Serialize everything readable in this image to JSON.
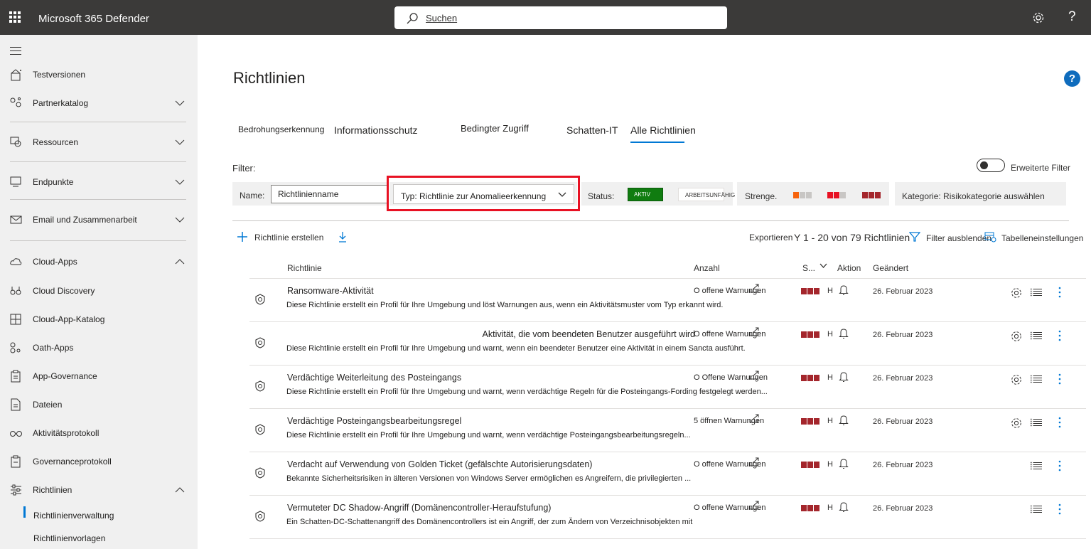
{
  "app": {
    "title": "Microsoft 365 Defender",
    "search_placeholder": "Suchen",
    "help": "?"
  },
  "sidebar": {
    "items": [
      {
        "label": "Testversionen",
        "icon": "trial-icon"
      },
      {
        "label": "Partnerkatalog",
        "icon": "partner-icon"
      },
      {
        "label": "Ressourcen",
        "icon": "resources-icon"
      },
      {
        "label": "Endpunkte",
        "icon": "endpoints-icon"
      },
      {
        "label": "Email und Zusammenarbeit",
        "icon": "email-icon"
      },
      {
        "label": "Cloud-Apps",
        "icon": "cloud-icon"
      },
      {
        "label": "Cloud Discovery",
        "icon": "binoculars-icon"
      },
      {
        "label": "Cloud-App-Katalog",
        "icon": "catalog-icon"
      },
      {
        "label": "Oath-Apps",
        "icon": "oauth-icon"
      },
      {
        "label": "App-Governance",
        "icon": "governance-icon"
      },
      {
        "label": "Dateien",
        "icon": "files-icon"
      },
      {
        "label": "Aktivitätsprotokoll",
        "icon": "glasses-icon"
      },
      {
        "label": "Governanceprotokoll",
        "icon": "log-icon"
      },
      {
        "label": "Richtlinien",
        "icon": "policies-icon"
      }
    ],
    "sub_items": [
      {
        "label": "Richtlinienverwaltung",
        "active": true
      },
      {
        "label": "Richtlinienvorlagen",
        "active": false
      }
    ]
  },
  "page": {
    "title": "Richtlinien",
    "help_label": "?"
  },
  "tabs": [
    {
      "label": "Bedrohungserkennung"
    },
    {
      "label": "Informationsschutz"
    },
    {
      "label": "Bedingter Zugriff"
    },
    {
      "label": "Schatten-IT"
    },
    {
      "label": "Alle Richtlinien",
      "active": true
    }
  ],
  "filters": {
    "label": "Filter:",
    "advanced_label": "Erweiterte Filter",
    "name_label": "Name:",
    "name_value": "Richtlinienname",
    "type_value": "Typ: Richtlinie zur Anomalieerkennung",
    "status_label": "Status:",
    "status_active": "AKTIV",
    "status_broken": "ARBEITSUNFÄHIG",
    "severity_label": "Strenge.",
    "category_value": "Kategorie: Risikokategorie auswählen"
  },
  "toolbar": {
    "create_label": "Richtlinie erstellen",
    "export_label": "Exportieren",
    "range_label": "Y 1 - 20 von 79 Richtlinien",
    "hide_filter_label": "Filter ausblenden",
    "table_settings_label": "Tabelleneinstellungen"
  },
  "table": {
    "headers": {
      "policy": "Richtlinie",
      "count": "Anzahl",
      "severity": "S...",
      "action": "Aktion",
      "modified": "Geändert"
    },
    "rows": [
      {
        "title": "Ransomware-Aktivität",
        "desc": "Diese Richtlinie erstellt ein Profil für Ihre Umgebung und löst Warnungen aus, wenn ein Aktivitätsmuster vom Typ erkannt wird.",
        "count": "O offene Warnungen",
        "h": "H",
        "date": "26. Februar 2023",
        "gear": true
      },
      {
        "title": "Aktivität, die vom beendeten Benutzer ausgeführt wird",
        "desc": "Diese Richtlinie erstellt ein Profil für Ihre Umgebung und warnt, wenn ein beendeter Benutzer eine Aktivität in einem Sancta ausführt.",
        "count": "O offene Warnungen",
        "h": "H",
        "date": "26. Februar 2023",
        "gear": true
      },
      {
        "title": "Verdächtige Weiterleitung des Posteingangs",
        "desc": "Diese Richtlinie erstellt ein Profil für Ihre Umgebung und warnt, wenn verdächtige Regeln für die Posteingangs-Fording festgelegt werden...",
        "count": "O Offene Warnungen",
        "h": "H",
        "date": "26. Februar 2023",
        "gear": true
      },
      {
        "title": "Verdächtige Posteingangsbearbeitungsregel",
        "desc": "Diese Richtlinie erstellt ein Profil für Ihre Umgebung und warnt, wenn verdächtige Posteingangsbearbeitungsregeln...",
        "count": "5 öffnen Warnungen",
        "h": "H",
        "date": "26. Februar 2023",
        "gear": true
      },
      {
        "title": "Verdacht auf Verwendung von Golden Ticket (gefälschte Autorisierungsdaten)",
        "desc": "Bekannte Sicherheitsrisiken in älteren Versionen von Windows Server ermöglichen es Angreifern, die privilegierten ...",
        "count": "O offene Warnungen",
        "h": "H",
        "date": "26. Februar 2023",
        "gear": false
      },
      {
        "title": "Vermuteter DC Shadow-Angriff (Domänencontroller-Heraufstufung)",
        "desc": "Ein Schatten-DC-Schattenangriff des Domänencontrollers ist ein Angriff, der zum Ändern von Verzeichnisobjekten mit",
        "count": "O offene Warnungen",
        "h": "H",
        "date": "26. Februar 2023",
        "gear": false
      }
    ]
  },
  "colors": {
    "accent": "#0078d4",
    "severity_high": "#a4262c",
    "status_active": "#107c10",
    "highlight_frame": "#e81123"
  }
}
